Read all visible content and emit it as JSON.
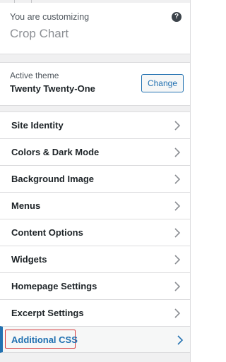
{
  "header": {
    "customizing_prefix": "You are customizing",
    "site_title": "Crop Chart",
    "help_icon": "help-icon"
  },
  "theme": {
    "label": "Active theme",
    "name": "Twenty Twenty-One",
    "change_label": "Change"
  },
  "menu": {
    "items": [
      {
        "label": "Site Identity"
      },
      {
        "label": "Colors & Dark Mode"
      },
      {
        "label": "Background Image"
      },
      {
        "label": "Menus"
      },
      {
        "label": "Content Options"
      },
      {
        "label": "Widgets"
      },
      {
        "label": "Homepage Settings"
      },
      {
        "label": "Excerpt Settings"
      },
      {
        "label": "Additional CSS"
      }
    ]
  },
  "colors": {
    "accent": "#2271b1",
    "highlight": "#d63638"
  }
}
